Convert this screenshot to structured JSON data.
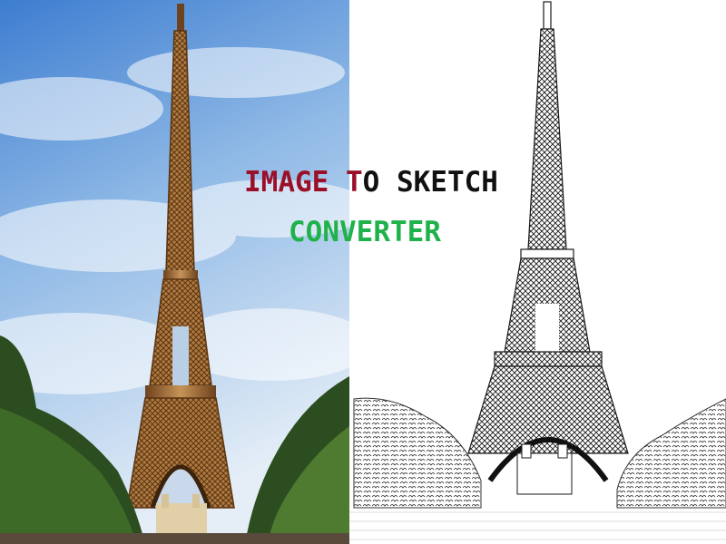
{
  "title": {
    "line1": [
      {
        "text": "IMAGE T",
        "color": "#9b1028"
      },
      {
        "text": "O SKETCH",
        "color": "#111111"
      }
    ],
    "line2": [
      {
        "text": "CONVERTER",
        "color": "#20b24a"
      }
    ]
  },
  "colors": {
    "sky_top": "#3d7dd0",
    "sky_mid": "#8fb9e6",
    "sky_bottom": "#dbe8f4",
    "tower_bronze": "#8a5a2c",
    "tower_light": "#c79358",
    "trees_dark": "#22401a",
    "trees_light": "#4f7b30",
    "sketch_ink": "#1a1a1a",
    "sketch_paper": "#ffffff"
  },
  "panels": {
    "left": "photo",
    "right": "sketch"
  }
}
